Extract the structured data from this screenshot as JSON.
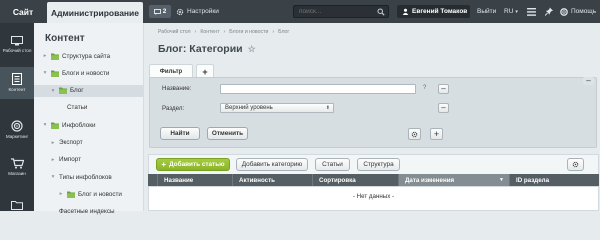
{
  "topbar": {
    "site_tab": "Сайт",
    "admin_tab": "Администрирование",
    "notifications_count": "2",
    "settings_label": "Настройки",
    "search_placeholder": "поиск...",
    "user_name": "Евгений Томаков",
    "logout_label": "Выйти",
    "language": "RU",
    "help_label": "Помощь"
  },
  "rail": {
    "items": [
      {
        "label": "Рабочий стол",
        "icon": "desktop-icon"
      },
      {
        "label": "Контент",
        "icon": "document-icon"
      },
      {
        "label": "Маркетинг",
        "icon": "target-icon"
      },
      {
        "label": "Магазин",
        "icon": "cart-icon"
      },
      {
        "label": "",
        "icon": "folder-icon"
      }
    ]
  },
  "tree": {
    "title": "Контент",
    "items": [
      {
        "label": "Структура сайта",
        "indent": 0,
        "arrow": "▸",
        "icon": "folder"
      },
      {
        "label": "Блоги и новости",
        "indent": 0,
        "arrow": "▾",
        "icon": "folder"
      },
      {
        "label": "Блог",
        "indent": 1,
        "arrow": "▾",
        "icon": "folder",
        "selected": true
      },
      {
        "label": "Статьи",
        "indent": 2,
        "arrow": "",
        "icon": "none"
      },
      {
        "label": "Инфоблоки",
        "indent": 0,
        "arrow": "▾",
        "icon": "folder"
      },
      {
        "label": "Экспорт",
        "indent": 1,
        "arrow": "▸",
        "icon": "none"
      },
      {
        "label": "Импорт",
        "indent": 1,
        "arrow": "▸",
        "icon": "none"
      },
      {
        "label": "Типы инфоблоков",
        "indent": 1,
        "arrow": "▾",
        "icon": "none"
      },
      {
        "label": "Блог и новости",
        "indent": 2,
        "arrow": "▸",
        "icon": "folder"
      },
      {
        "label": "Фасетные индексы",
        "indent": 1,
        "arrow": "",
        "icon": "none"
      }
    ]
  },
  "main": {
    "breadcrumbs": [
      "Рабочий стол",
      "Контент",
      "Блоги и новости",
      "Блог"
    ],
    "breadcrumb_sep": "›",
    "title": "Блог: Категории",
    "filter": {
      "tab_label": "Фильтр",
      "add_tab": "+",
      "name_label": "Название:",
      "name_value": "",
      "help": "?",
      "section_label": "Раздел:",
      "section_value": "Верхний уровень",
      "find_button": "Найти",
      "cancel_button": "Отменить"
    },
    "toolbar": {
      "add_article": "Добавить статью",
      "add_category": "Добавить категорию",
      "articles": "Статьи",
      "structure": "Структура"
    },
    "table": {
      "columns": [
        "Название",
        "Активность",
        "Сортировка",
        "Дата изменения",
        "ID раздела"
      ],
      "sorted_column": "Дата изменения",
      "empty_text": "- Нет данных -"
    }
  },
  "colors": {
    "topbar_bg": "#3a4248",
    "rail_bg": "#2f373c",
    "accent_green": "#8bb42a",
    "table_header": "#555e63"
  }
}
